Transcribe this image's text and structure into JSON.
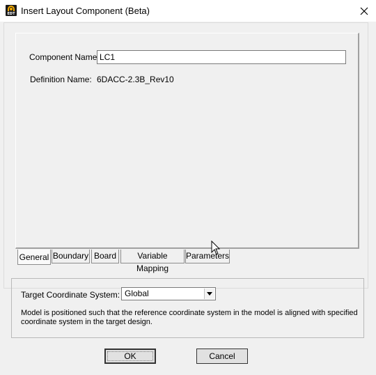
{
  "window": {
    "title": "Insert Layout Component (Beta)",
    "app_icon": "edt-app-icon",
    "app_icon_text": "EDT",
    "close": "close-icon"
  },
  "form": {
    "component_name_label": "Component Name:",
    "component_name_value": "LC1",
    "definition_name_label": "Definition Name:",
    "definition_name_value": "6DACC-2.3B_Rev10"
  },
  "tabs": [
    {
      "label": "General",
      "active": true
    },
    {
      "label": "Boundary",
      "active": false
    },
    {
      "label": "Board",
      "active": false
    },
    {
      "label": "Variable Mapping",
      "active": false
    },
    {
      "label": "Parameters",
      "active": false
    }
  ],
  "target": {
    "label": "Target Coordinate System:",
    "selected": "Global",
    "description": "Model is positioned such that the reference coordinate system in the model is aligned with specified coordinate system in the target design."
  },
  "buttons": {
    "ok": "OK",
    "cancel": "Cancel"
  }
}
